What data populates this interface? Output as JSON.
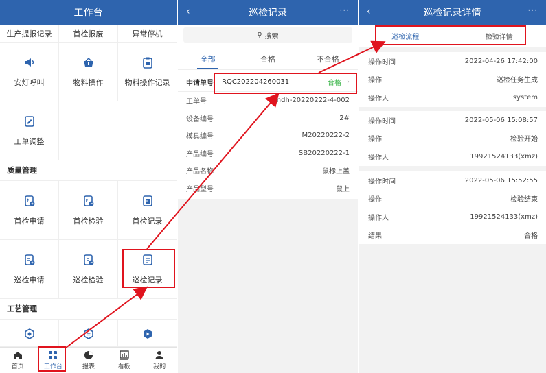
{
  "workbench": {
    "title": "工作台",
    "clipped_row": [
      "生产提报记录",
      "首检报废",
      "异常停机"
    ],
    "row1": [
      {
        "label": "安灯呼叫",
        "icon": "megaphone-icon"
      },
      {
        "label": "物料操作",
        "icon": "basket-icon"
      },
      {
        "label": "物料操作记录",
        "icon": "clipboard-icon"
      }
    ],
    "row2": [
      {
        "label": "工单调整",
        "icon": "edit-doc-icon"
      }
    ],
    "section_quality": "质量管理",
    "row3": [
      {
        "label": "首检申请",
        "icon": "doc-apply-icon"
      },
      {
        "label": "首检检验",
        "icon": "doc-check-icon"
      },
      {
        "label": "首检记录",
        "icon": "doc-record-icon"
      }
    ],
    "row4": [
      {
        "label": "巡检申请",
        "icon": "doc-apply-icon"
      },
      {
        "label": "巡检检验",
        "icon": "doc-check-icon"
      },
      {
        "label": "巡检记录",
        "icon": "doc-record-icon"
      }
    ],
    "section_process": "工艺管理",
    "bottom_nav": [
      {
        "label": "首页",
        "icon": "home-icon"
      },
      {
        "label": "工作台",
        "icon": "grid-icon"
      },
      {
        "label": "报表",
        "icon": "pie-chart-icon"
      },
      {
        "label": "看板",
        "icon": "bar-chart-icon"
      },
      {
        "label": "我的",
        "icon": "user-icon"
      }
    ]
  },
  "records": {
    "title": "巡检记录",
    "back": "‹",
    "more": "···",
    "search": "搜索",
    "tabs": [
      "全部",
      "合格",
      "不合格"
    ],
    "item": {
      "request_label": "申请单号",
      "request_no": "RQC202204260031",
      "status": "合格",
      "rows": [
        {
          "label": "工单号",
          "value": "jhdh-20220222-4-002"
        },
        {
          "label": "设备编号",
          "value": "2#"
        },
        {
          "label": "模具编号",
          "value": "M20220222-2"
        },
        {
          "label": "产品编号",
          "value": "SB20220222-1"
        },
        {
          "label": "产品名称",
          "value": "鼠标上盖"
        },
        {
          "label": "产品型号",
          "value": "鼠上"
        }
      ]
    }
  },
  "detail": {
    "title": "巡检记录详情",
    "back": "‹",
    "more": "···",
    "tabs": [
      "巡检流程",
      "检验详情"
    ],
    "cards": [
      {
        "rows": [
          {
            "label": "操作时间",
            "value": "2022-04-26 17:42:00"
          },
          {
            "label": "操作",
            "value": "巡检任务生成"
          },
          {
            "label": "操作人",
            "value": "system"
          }
        ]
      },
      {
        "rows": [
          {
            "label": "操作时间",
            "value": "2022-05-06 15:08:57"
          },
          {
            "label": "操作",
            "value": "检验开始"
          },
          {
            "label": "操作人",
            "value": "19921524133(xmz)"
          }
        ]
      },
      {
        "rows": [
          {
            "label": "操作时间",
            "value": "2022-05-06 15:52:55"
          },
          {
            "label": "操作",
            "value": "检验结束"
          },
          {
            "label": "操作人",
            "value": "19921524133(xmz)"
          },
          {
            "label": "结果",
            "value": "合格"
          }
        ]
      }
    ]
  },
  "colors": {
    "header": "#2e64ae",
    "accent": "#2e64ae",
    "pass": "#3bb54a",
    "annotation": "#e0141e"
  }
}
